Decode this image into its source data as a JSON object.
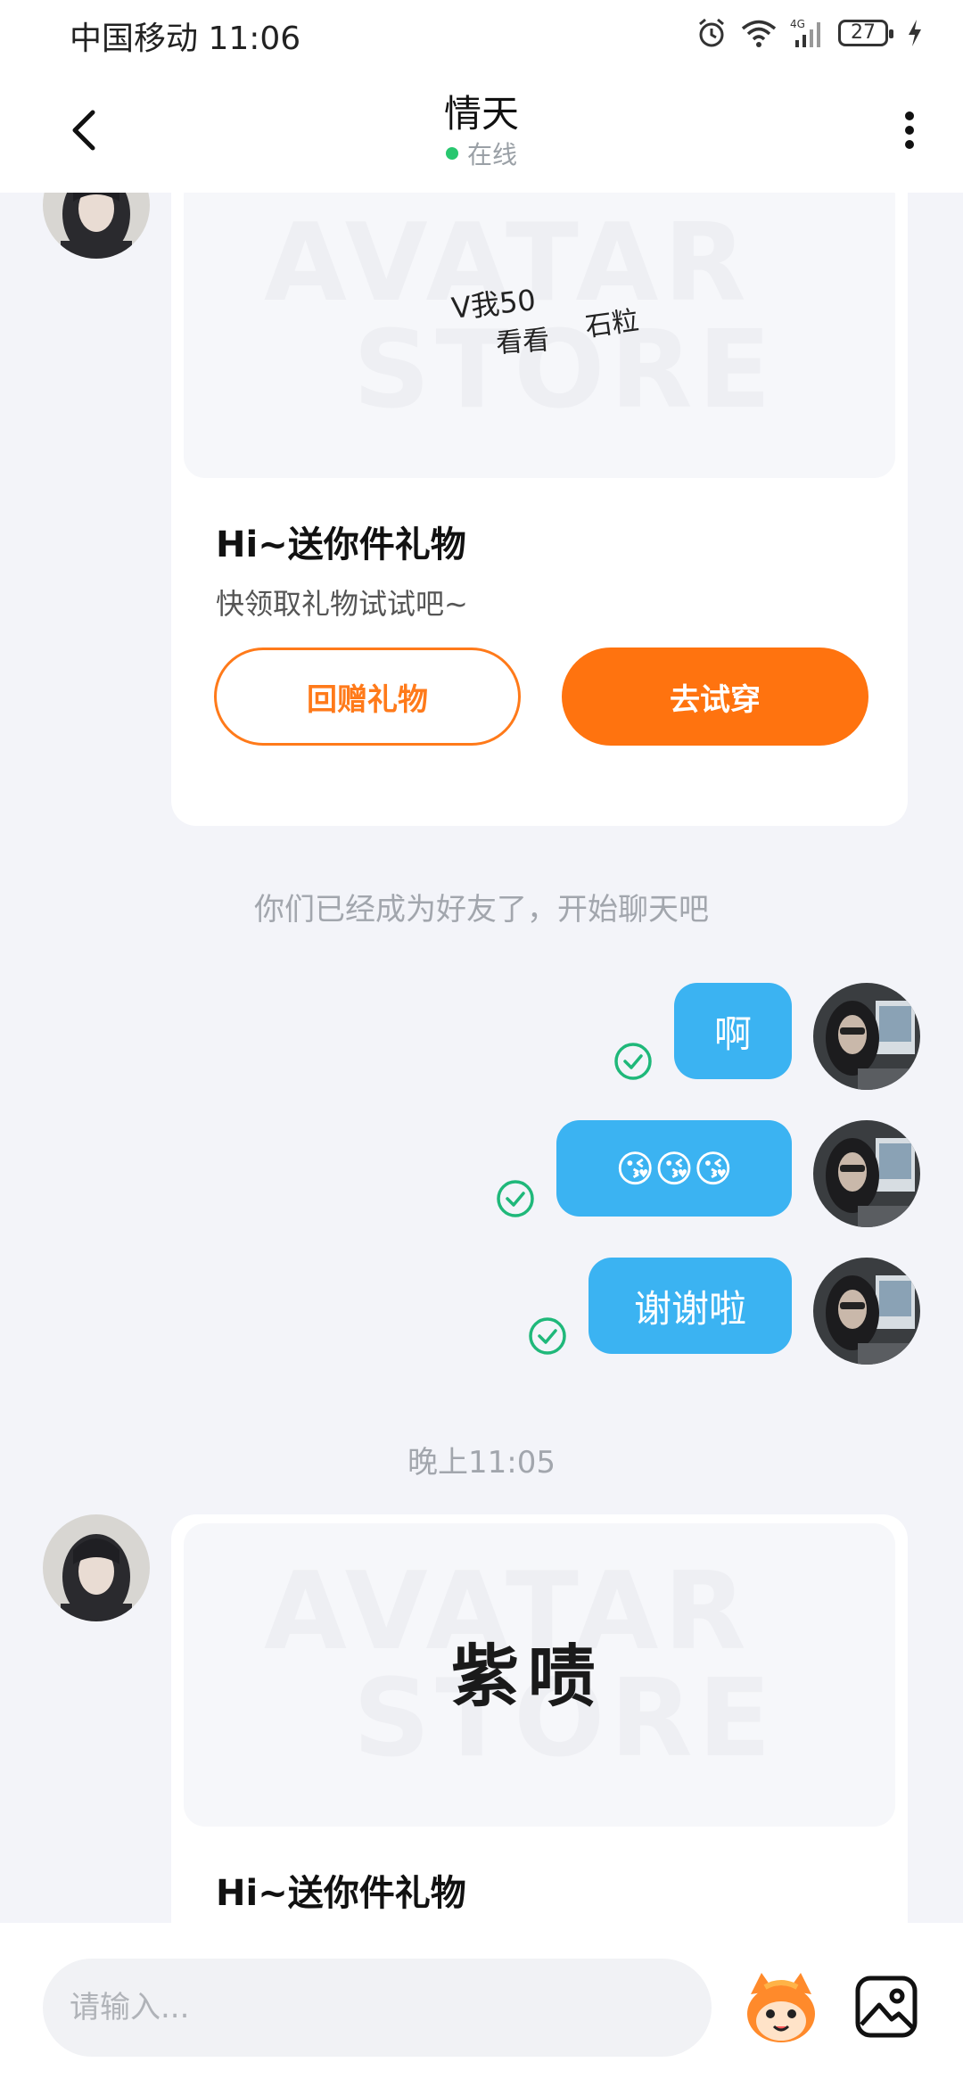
{
  "status": {
    "carrier_time": "中国移动 11:06",
    "battery": "27"
  },
  "header": {
    "title": "情天",
    "online": "在线"
  },
  "gift_card_1": {
    "image_text_line1": "V我50",
    "image_text_line2": "看看",
    "image_text_line3": "石粒",
    "watermark_line1": "AVATAR",
    "watermark_line2": "STORE",
    "title": "Hi~送你件礼物",
    "description": "快领取礼物试试吧~",
    "return_gift_label": "回赠礼物",
    "try_on_label": "去试穿"
  },
  "system_message": "你们已经成为好友了，开始聊天吧",
  "messages": [
    {
      "text": "啊"
    },
    {
      "text": "😘😘😘"
    },
    {
      "text": "谢谢啦"
    }
  ],
  "timestamp": "晚上11:05",
  "gift_card_2": {
    "image_text": "紫啧",
    "watermark_line1": "AVATAR",
    "watermark_line2": "STORE",
    "title": "Hi~送你件礼物"
  },
  "input": {
    "placeholder": "请输入..."
  },
  "colors": {
    "accent_orange": "#ff730f",
    "bubble_blue": "#3bb3f2",
    "online_green": "#28c76f",
    "check_green": "#1fb87a"
  }
}
